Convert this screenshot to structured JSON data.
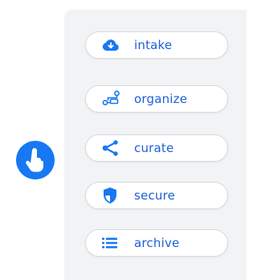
{
  "colors": {
    "accent": "#1877f2",
    "label": "#1d5fd6",
    "panel": "#f2f3f5",
    "button_border": "#d7d9dd"
  },
  "pointer": {
    "icon": "tap-hand-icon"
  },
  "menu": {
    "items": [
      {
        "label": "intake",
        "icon": "cloud-download-icon"
      },
      {
        "label": "organize",
        "icon": "hierarchy-icon"
      },
      {
        "label": "curate",
        "icon": "share-icon"
      },
      {
        "label": "secure",
        "icon": "shield-icon"
      },
      {
        "label": "archive",
        "icon": "list-icon"
      }
    ]
  }
}
